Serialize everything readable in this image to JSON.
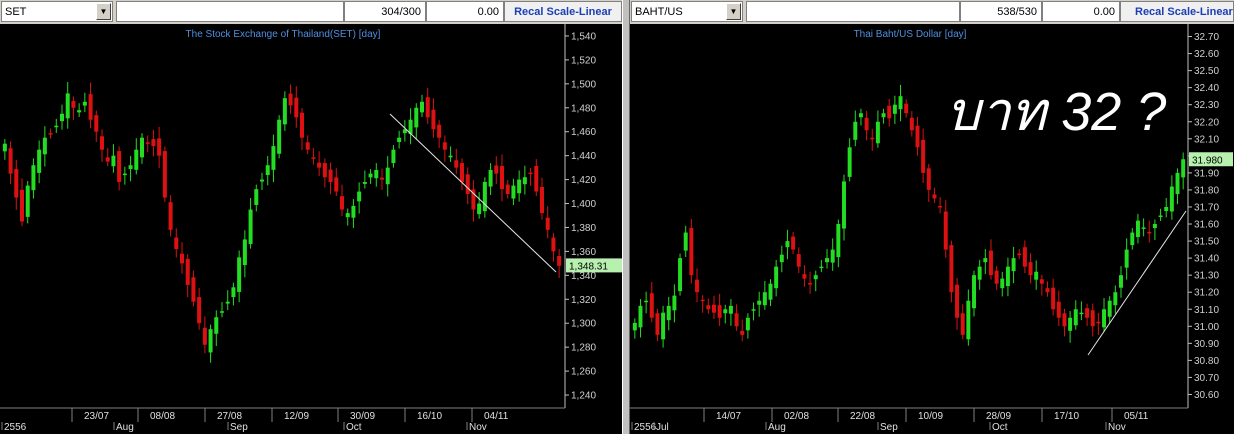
{
  "left": {
    "symbol": "SET",
    "count": "304/300",
    "value": "0.00",
    "recal_label": "Recal Scale-Linear",
    "chart_title": "The Stock Exchange of Thailand(SET) [day]",
    "price_label": "1,348.31",
    "date_ticks": [
      "23/07",
      "08/08",
      "27/08",
      "12/09",
      "30/09",
      "16/10",
      "04/11"
    ],
    "bottom_labels": [
      "2556",
      "Aug",
      "Sep",
      "Oct",
      "Nov"
    ]
  },
  "right": {
    "symbol": "BAHT/US",
    "count": "538/530",
    "value": "0.00",
    "recal_label": "Recal Scale-Linear",
    "chart_title": "Thai Baht/US Dollar [day]",
    "price_label": "31.980",
    "annotation": "บาท 32 ?",
    "date_ticks": [
      "14/07",
      "02/08",
      "22/08",
      "10/09",
      "28/09",
      "17/10",
      "05/11"
    ],
    "bottom_labels": [
      "2556",
      "Jul",
      "Aug",
      "Sep",
      "Oct",
      "Nov"
    ]
  },
  "colors": {
    "up": "#22dd22",
    "down": "#dd1111",
    "title": "#4f8fe0",
    "grid": "#808080",
    "price_bg": "#b8f0b0"
  },
  "chart_data": [
    {
      "type": "candlestick",
      "title": "The Stock Exchange of Thailand(SET) [day]",
      "y_ticks": [
        "1,540",
        "1,520",
        "1,500",
        "1,480",
        "1,460",
        "1,440",
        "1,420",
        "1,400",
        "1,380",
        "1,360",
        "1,340",
        "1,320",
        "1,300",
        "1,280",
        "1,260",
        "1,240"
      ],
      "ylim": [
        1230,
        1550
      ],
      "last": 1348.31,
      "x_ticks": [
        "23/07",
        "08/08",
        "27/08",
        "12/09",
        "30/09",
        "16/10",
        "04/11"
      ],
      "close_path": [
        1450,
        1425,
        1405,
        1385,
        1415,
        1432,
        1445,
        1455,
        1458,
        1465,
        1475,
        1492,
        1480,
        1478,
        1485,
        1470,
        1460,
        1445,
        1435,
        1440,
        1418,
        1425,
        1432,
        1445,
        1455,
        1450,
        1448,
        1440,
        1405,
        1378,
        1362,
        1350,
        1332,
        1318,
        1300,
        1282,
        1295,
        1305,
        1310,
        1318,
        1330,
        1355,
        1370,
        1395,
        1412,
        1420,
        1432,
        1448,
        1470,
        1488,
        1482,
        1472,
        1455,
        1445,
        1438,
        1430,
        1422,
        1418,
        1410,
        1395,
        1392,
        1398,
        1410,
        1418,
        1425,
        1428,
        1420,
        1430,
        1445,
        1455,
        1462,
        1470,
        1480,
        1485,
        1472,
        1462,
        1455,
        1445,
        1440,
        1430,
        1418,
        1408,
        1395,
        1400,
        1418,
        1428,
        1425,
        1412,
        1408,
        1415,
        1420,
        1422,
        1425,
        1410,
        1392,
        1378,
        1360,
        1348
      ]
    },
    {
      "type": "candlestick",
      "title": "Thai Baht/US Dollar [day]",
      "y_ticks": [
        "32.70",
        "32.60",
        "32.50",
        "32.40",
        "32.30",
        "32.20",
        "32.10",
        "32.00",
        "31.90",
        "31.80",
        "31.70",
        "31.60",
        "31.50",
        "31.40",
        "31.30",
        "31.20",
        "31.10",
        "31.00",
        "30.90",
        "30.80",
        "30.70",
        "30.60"
      ],
      "ylim": [
        30.55,
        32.75
      ],
      "last": 31.98,
      "x_ticks": [
        "14/07",
        "02/08",
        "22/08",
        "10/09",
        "28/09",
        "17/10",
        "05/11"
      ],
      "close_path": [
        31.02,
        31.12,
        31.15,
        31.05,
        30.95,
        31.08,
        31.12,
        31.18,
        31.4,
        31.55,
        31.3,
        31.2,
        31.15,
        31.1,
        31.08,
        31.05,
        31.1,
        31.12,
        31.0,
        30.95,
        31.05,
        31.1,
        31.15,
        31.2,
        31.25,
        31.35,
        31.42,
        31.5,
        31.45,
        31.35,
        31.28,
        31.25,
        31.3,
        31.35,
        31.4,
        31.45,
        31.6,
        31.85,
        32.05,
        32.2,
        32.25,
        32.15,
        32.1,
        32.2,
        32.25,
        32.22,
        32.3,
        32.35,
        32.25,
        32.15,
        32.05,
        31.9,
        31.8,
        31.75,
        31.7,
        31.45,
        31.2,
        31.05,
        30.95,
        31.15,
        31.3,
        31.35,
        31.4,
        31.3,
        31.25,
        31.28,
        31.35,
        31.4,
        31.42,
        31.35,
        31.3,
        31.32,
        31.25,
        31.2,
        31.1,
        31.05,
        31.0,
        31.05,
        31.1,
        31.08,
        31.05,
        31.0,
        31.02,
        31.1,
        31.15,
        31.2,
        31.3,
        31.45,
        31.55,
        31.62,
        31.58,
        31.55,
        31.6,
        31.65,
        31.7,
        31.82,
        31.9,
        31.98
      ]
    }
  ]
}
